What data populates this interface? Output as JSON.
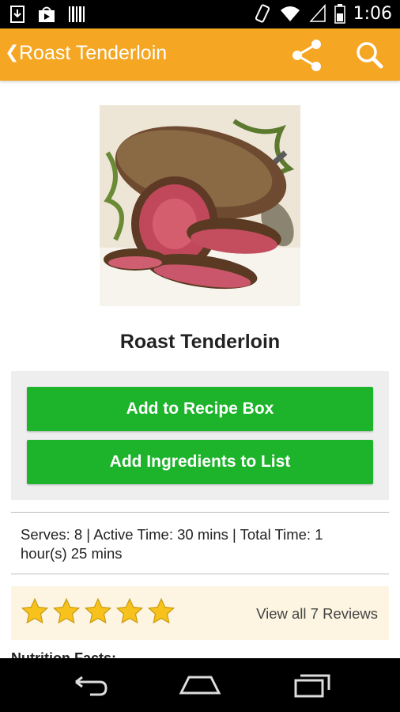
{
  "status_bar": {
    "time": "1:06",
    "left_icons": [
      "download-icon",
      "play-store-icon",
      "barcode-icon"
    ],
    "right_icons": [
      "vibrate-icon",
      "wifi-icon",
      "signal-icon",
      "battery-icon"
    ]
  },
  "action_bar": {
    "back_glyph": "❮",
    "title": "Roast Tenderloin",
    "actions": [
      "share-icon",
      "search-icon"
    ]
  },
  "recipe": {
    "image_alt": "Roast tenderloin with herbs",
    "title": "Roast Tenderloin",
    "buttons": {
      "add_to_box": "Add to Recipe Box",
      "add_ingredients": "Add Ingredients to List"
    },
    "meta_text": "Serves: 8 | Active Time: 30 mins | Total Time: 1 hour(s) 25 mins",
    "rating": {
      "stars": 5,
      "max": 5,
      "reviews_label": "View all 7 Reviews"
    },
    "nutrition_heading": "Nutrition Facts:"
  },
  "colors": {
    "accent": "#f5a623",
    "button_green": "#1db32b",
    "panel_gray": "#eeeeee",
    "rating_bg": "#fdf5e1",
    "star": "#f7c21c"
  },
  "nav_bar": {
    "buttons": [
      "back-nav-icon",
      "home-nav-icon",
      "recents-nav-icon"
    ]
  }
}
